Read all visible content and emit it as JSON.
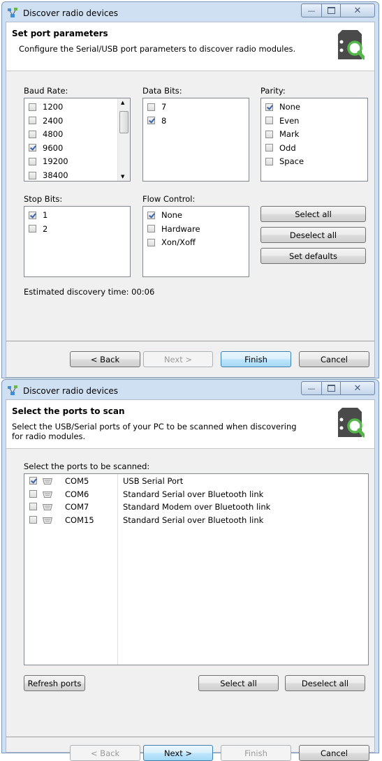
{
  "dialog1": {
    "title": "Discover radio devices",
    "header_title": "Set port parameters",
    "header_desc": "Configure the Serial/USB port parameters to discover radio modules.",
    "baud_label": "Baud Rate:",
    "baud_items": [
      {
        "label": "1200",
        "checked": false
      },
      {
        "label": "2400",
        "checked": false
      },
      {
        "label": "4800",
        "checked": false
      },
      {
        "label": "9600",
        "checked": true
      },
      {
        "label": "19200",
        "checked": false
      },
      {
        "label": "38400",
        "checked": false
      }
    ],
    "databits_label": "Data Bits:",
    "databits_items": [
      {
        "label": "7",
        "checked": false
      },
      {
        "label": "8",
        "checked": true
      }
    ],
    "parity_label": "Parity:",
    "parity_items": [
      {
        "label": "None",
        "checked": true
      },
      {
        "label": "Even",
        "checked": false
      },
      {
        "label": "Mark",
        "checked": false
      },
      {
        "label": "Odd",
        "checked": false
      },
      {
        "label": "Space",
        "checked": false
      }
    ],
    "stopbits_label": "Stop Bits:",
    "stopbits_items": [
      {
        "label": "1",
        "checked": true
      },
      {
        "label": "2",
        "checked": false
      }
    ],
    "flow_label": "Flow Control:",
    "flow_items": [
      {
        "label": "None",
        "checked": true
      },
      {
        "label": "Hardware",
        "checked": false
      },
      {
        "label": "Xon/Xoff",
        "checked": false
      }
    ],
    "select_all": "Select all",
    "deselect_all": "Deselect all",
    "set_defaults": "Set defaults",
    "estimate": "Estimated discovery time: 00:06",
    "back": "< Back",
    "next": "Next >",
    "finish": "Finish",
    "cancel": "Cancel"
  },
  "dialog2": {
    "title": "Discover radio devices",
    "header_title": "Select the ports to scan",
    "header_desc_1": "Select the USB/Serial ports of your PC to be scanned when discovering",
    "header_desc_2": "for radio modules.",
    "ports_label": "Select the ports to be scanned:",
    "ports": [
      {
        "port": "COM5",
        "desc": "USB Serial Port",
        "checked": true
      },
      {
        "port": "COM6",
        "desc": "Standard Serial over Bluetooth link",
        "checked": false
      },
      {
        "port": "COM7",
        "desc": "Standard Modem over Bluetooth link",
        "checked": false
      },
      {
        "port": "COM15",
        "desc": "Standard Serial over Bluetooth link",
        "checked": false
      }
    ],
    "refresh": "Refresh ports",
    "select_all": "Select all",
    "deselect_all": "Deselect all",
    "back": "< Back",
    "next": "Next >",
    "finish": "Finish",
    "cancel": "Cancel"
  },
  "icons": {
    "app": "network-devices-icon",
    "header": "radio-search-icon",
    "port": "serial-port-icon"
  },
  "colors": {
    "accent": "#3c7fb1",
    "window_frame": "#cfe0f3",
    "logo_gray": "#4a4a4a",
    "logo_green": "#53b848"
  }
}
